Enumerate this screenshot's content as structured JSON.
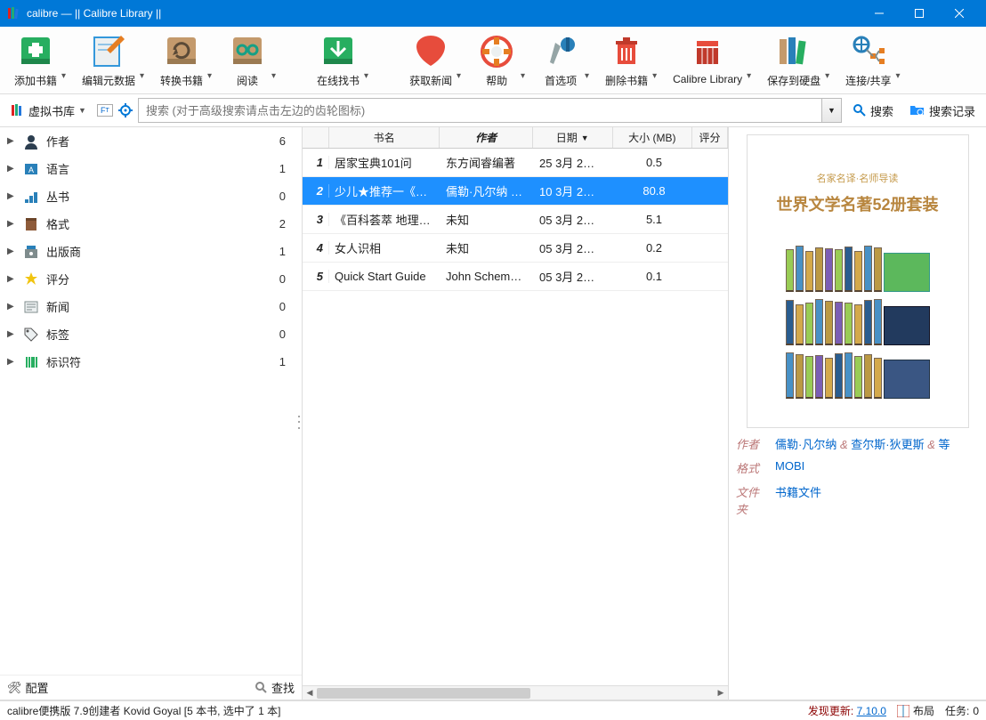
{
  "window": {
    "title": "calibre — || Calibre Library ||"
  },
  "toolbar": [
    {
      "id": "add-books",
      "label": "添加书籍",
      "hasDrop": true
    },
    {
      "id": "edit-meta",
      "label": "编辑元数据",
      "hasDrop": true
    },
    {
      "id": "convert",
      "label": "转换书籍",
      "hasDrop": true
    },
    {
      "id": "view",
      "label": "阅读",
      "hasDrop": true
    },
    {
      "id": "find-online",
      "label": "在线找书",
      "hasDrop": true
    },
    {
      "id": "fetch-news",
      "label": "获取新闻",
      "hasDrop": true
    },
    {
      "id": "help",
      "label": "帮助",
      "hasDrop": true
    },
    {
      "id": "prefs",
      "label": "首选项",
      "hasDrop": true
    },
    {
      "id": "delete",
      "label": "删除书籍",
      "hasDrop": true
    },
    {
      "id": "library",
      "label": "Calibre Library",
      "hasDrop": true
    },
    {
      "id": "save-disk",
      "label": "保存到硬盘",
      "hasDrop": true
    },
    {
      "id": "connect",
      "label": "连接/共享",
      "hasDrop": true
    }
  ],
  "searchrow": {
    "virtual_lib": "虚拟书库",
    "placeholder": "搜索 (对于高级搜索请点击左边的齿轮图标)",
    "search_btn": "搜索",
    "history_btn": "搜索记录"
  },
  "sidebar": {
    "items": [
      {
        "icon": "author",
        "label": "作者",
        "count": "6"
      },
      {
        "icon": "lang",
        "label": "语言",
        "count": "1"
      },
      {
        "icon": "series",
        "label": "丛书",
        "count": "0"
      },
      {
        "icon": "format",
        "label": "格式",
        "count": "2"
      },
      {
        "icon": "publisher",
        "label": "出版商",
        "count": "1"
      },
      {
        "icon": "rating",
        "label": "评分",
        "count": "0"
      },
      {
        "icon": "news",
        "label": "新闻",
        "count": "0"
      },
      {
        "icon": "tags",
        "label": "标签",
        "count": "0"
      },
      {
        "icon": "ids",
        "label": "标识符",
        "count": "1"
      }
    ],
    "config": "配置",
    "find": "查找"
  },
  "table": {
    "headers": {
      "num": "",
      "title": "书名",
      "author": "作者",
      "date": "日期",
      "size": "大小 (MB)",
      "rating": "评分"
    },
    "rows": [
      {
        "n": "1",
        "title": "居家宝典101问",
        "author": "东方闻睿编著",
        "date": "25 3月 2…",
        "size": "0.5",
        "selected": false
      },
      {
        "n": "2",
        "title": "少儿★推荐一《…",
        "author": "儒勒·凡尔纳 &…",
        "date": "10 3月 2…",
        "size": "80.8",
        "selected": true
      },
      {
        "n": "3",
        "title": "《百科荟萃 地理…",
        "author": "未知",
        "date": "05 3月 2…",
        "size": "5.1",
        "selected": false
      },
      {
        "n": "4",
        "title": "女人识相",
        "author": "未知",
        "date": "05 3月 2…",
        "size": "0.2",
        "selected": false
      },
      {
        "n": "5",
        "title": "Quick Start Guide",
        "author": "John Schem…",
        "date": "05 3月 2…",
        "size": "0.1",
        "selected": false
      }
    ]
  },
  "detail": {
    "cover_sub": "名家名译·名师导读",
    "cover_title": "世界文学名著52册套装",
    "author_label": "作者",
    "authors": [
      "儒勒·凡尔纳",
      "查尔斯·狄更斯",
      "等"
    ],
    "format_label": "格式",
    "format": "MOBI",
    "folder_label": "文件夹",
    "folder": "书籍文件"
  },
  "status": {
    "left": "calibre便携版 7.9创建者 Kovid Goyal   [5 本书, 选中了 1 本]",
    "update_prefix": "发现更新:",
    "update_ver": "7.10.0",
    "layout": "布局",
    "jobs_label": "任务:",
    "jobs_count": "0"
  }
}
